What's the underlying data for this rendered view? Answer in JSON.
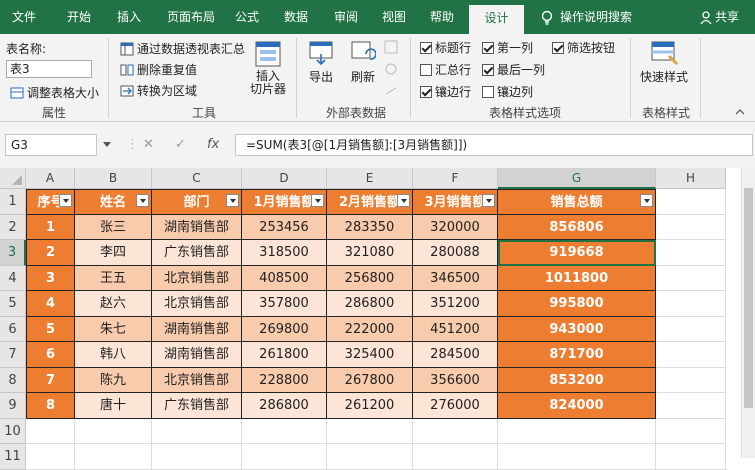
{
  "tabs": [
    "文件",
    "开始",
    "插入",
    "页面布局",
    "公式",
    "数据",
    "审阅",
    "视图",
    "帮助",
    "设计"
  ],
  "active_tab": "设计",
  "tell_me": "操作说明搜索",
  "share": "共享",
  "ribbon": {
    "props": {
      "label": "表名称:",
      "table_name": "表3",
      "resize": "调整表格大小",
      "group": "属性"
    },
    "tools": {
      "pivot": "通过数据透视表汇总",
      "remove_dup": "删除重复值",
      "convert": "转换为区域",
      "slicer": "插入\n切片器",
      "group": "工具"
    },
    "external": {
      "export": "导出",
      "refresh": "刷新",
      "group": "外部表数据"
    },
    "style_options": {
      "header_row": "标题行",
      "total_row": "汇总行",
      "banded_rows": "镶边行",
      "first_col": "第一列",
      "last_col": "最后一列",
      "banded_cols": "镶边列",
      "filter_btn": "筛选按钮",
      "group": "表格样式选项"
    },
    "styles": {
      "quick": "快速样式",
      "group": "表格样式"
    }
  },
  "formula_bar": {
    "name_box": "G3",
    "cancel": "✕",
    "enter": "✓",
    "fx": "fx",
    "formula": "=SUM(表3[@[1月销售额]:[3月销售额]])"
  },
  "columns": [
    "A",
    "B",
    "C",
    "D",
    "E",
    "F",
    "G",
    "H"
  ],
  "rows": [
    "1",
    "2",
    "3",
    "4",
    "5",
    "6",
    "7",
    "8",
    "9",
    "10",
    "11"
  ],
  "table": {
    "headers": [
      "序号",
      "姓名",
      "部门",
      "1月销售额",
      "2月销售额",
      "3月销售额",
      "销售总额"
    ],
    "rows": [
      [
        "1",
        "张三",
        "湖南销售部",
        "253456",
        "283350",
        "320000",
        "856806"
      ],
      [
        "2",
        "李四",
        "广东销售部",
        "318500",
        "321080",
        "280088",
        "919668"
      ],
      [
        "3",
        "王五",
        "北京销售部",
        "408500",
        "256800",
        "346500",
        "1011800"
      ],
      [
        "4",
        "赵六",
        "北京销售部",
        "357800",
        "286800",
        "351200",
        "995800"
      ],
      [
        "5",
        "朱七",
        "湖南销售部",
        "269800",
        "222000",
        "451200",
        "943000"
      ],
      [
        "6",
        "韩八",
        "湖南销售部",
        "261800",
        "325400",
        "284500",
        "871700"
      ],
      [
        "7",
        "陈九",
        "北京销售部",
        "228800",
        "267800",
        "356600",
        "853200"
      ],
      [
        "8",
        "唐十",
        "广东销售部",
        "286800",
        "261200",
        "276000",
        "824000"
      ]
    ]
  },
  "colors": {
    "green": "#217346",
    "header": "#ed7d31",
    "band_dark": "#f8cbad",
    "band_light": "#fce4d6"
  }
}
